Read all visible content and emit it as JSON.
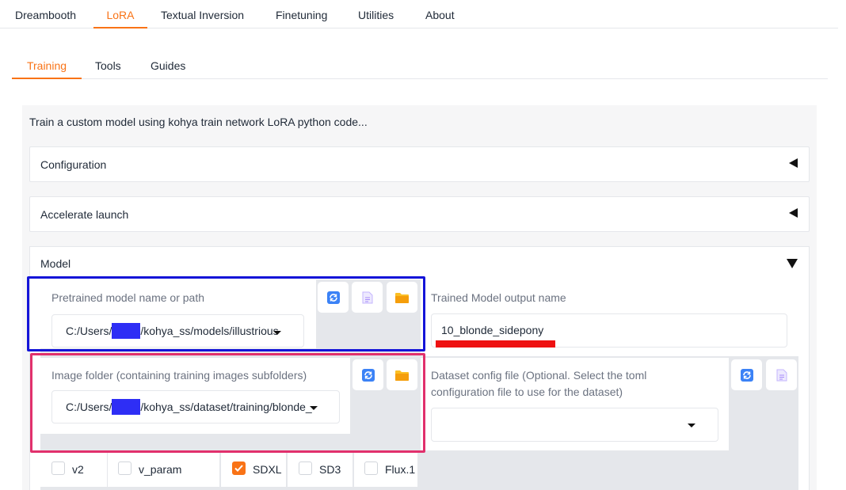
{
  "top_tabs": [
    {
      "label": "Dreambooth"
    },
    {
      "label": "LoRA"
    },
    {
      "label": "Textual Inversion"
    },
    {
      "label": "Finetuning"
    },
    {
      "label": "Utilities"
    },
    {
      "label": "About"
    }
  ],
  "active_top_tab": "LoRA",
  "sub_tabs": [
    {
      "label": "Training"
    },
    {
      "label": "Tools"
    },
    {
      "label": "Guides"
    }
  ],
  "active_sub_tab": "Training",
  "description": "Train a custom model using kohya train network LoRA python code...",
  "accordions": {
    "configuration": "Configuration",
    "accelerate": "Accelerate launch",
    "model": "Model"
  },
  "fields": {
    "pretrained": {
      "label": "Pretrained model name or path",
      "value_prefix": "C:/Users/",
      "value_suffix": "/kohya_ss/models/illustrious"
    },
    "output_name": {
      "label": "Trained Model output name",
      "value": "10_blonde_sidepony"
    },
    "image_folder": {
      "label": "Image folder (containing training images subfolders)",
      "value_prefix": "C:/Users/",
      "value_suffix": "/kohya_ss/dataset/training/blonde_"
    },
    "dataset_config": {
      "label_line1": "Dataset config file (Optional. Select the toml",
      "label_line2": "configuration file to use for the dataset)",
      "value": ""
    }
  },
  "checkboxes": [
    {
      "label": "v2",
      "checked": false
    },
    {
      "label": "v_param",
      "checked": false
    },
    {
      "label": "SDXL",
      "checked": true
    },
    {
      "label": "SD3",
      "checked": false
    },
    {
      "label": "Flux.1",
      "checked": false
    }
  ],
  "colors": {
    "accent": "#f97316",
    "highlight_blue": "#1414d8",
    "highlight_pink": "#e1306c",
    "highlight_red": "#ee1111",
    "redaction": "#2e2ef5"
  },
  "icons": {
    "refresh": "refresh-icon",
    "file": "file-icon",
    "folder": "folder-icon"
  }
}
